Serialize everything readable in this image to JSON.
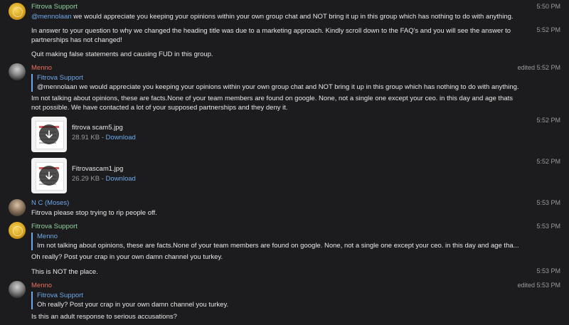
{
  "messages": {
    "m1": {
      "name": "Fitrova Support",
      "time": "5:50 PM",
      "mention": "@mennolaan",
      "text": " we would appreciate you keeping your opinions within your own group chat and NOT bring it up in this group which has nothing to do with anything."
    },
    "m2": {
      "time": "5:52 PM",
      "text": "In answer to your question to why we changed the heading title was due to a marketing approach. Kindly scroll down to the FAQ's and you will see the answer to partnerships has not changed!",
      "text2": "Quit making false statements and causing FUD in this group."
    },
    "m3": {
      "name": "Menno",
      "time": "edited  5:52 PM",
      "quote_name": "Fitrova Support",
      "quote_text": "@mennolaan we would appreciate you keeping your opinions within your own group chat and NOT bring it up in this group which has nothing to do with anything.",
      "text": "Im not talking about opinions, these are facts.None of your team members are found on google. None, not a single one except your ceo. in this day and age thats not possible. We have contacted a lot of your supposed partnerships and they deny it."
    },
    "f1": {
      "time": "5:52 PM",
      "filename": "fitrova scam5.jpg",
      "size": "28.91 KB",
      "sep": " - ",
      "download": "Download"
    },
    "f2": {
      "time": "5:52 PM",
      "filename": "Fitrovascam1.jpg",
      "size": "26.29 KB",
      "sep": " - ",
      "download": "Download"
    },
    "m4": {
      "name": "N C (Moses)",
      "time": "5:53 PM",
      "text": "Fitrova please stop trying to rip people off."
    },
    "m5": {
      "name": "Fitrova Support",
      "time": "5:53 PM",
      "quote_name": "Menno",
      "quote_text": "Im not talking about opinions, these are facts.None of your team members are found on google. None, not a single one except your ceo. in this day and age tha...",
      "text": "Oh really? Post your crap in your own damn channel you turkey."
    },
    "m6": {
      "time": "5:53 PM",
      "text": "This is NOT the place."
    },
    "m7": {
      "name": "Menno",
      "time": "edited  5:53 PM",
      "quote_name": "Fitrova Support",
      "quote_text": "Oh really? Post your crap in your own damn channel you turkey.",
      "text": "Is this an adult response to serious accusations?"
    }
  },
  "icons": {
    "download": "download-arrow-icon"
  }
}
